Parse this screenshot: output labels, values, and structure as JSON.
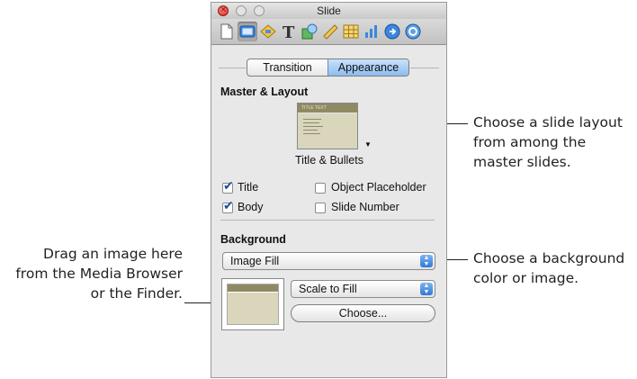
{
  "window": {
    "title": "Slide"
  },
  "toolbar": {
    "icons": [
      "document-icon",
      "slide-icon",
      "build-icon",
      "text-icon",
      "graphic-icon",
      "metrics-icon",
      "table-icon",
      "chart-icon",
      "hyperlink-icon",
      "quicktime-icon"
    ]
  },
  "tabs": {
    "transition": "Transition",
    "appearance": "Appearance",
    "active": "Appearance"
  },
  "master_layout": {
    "heading": "Master & Layout",
    "layout_name": "Title & Bullets",
    "thumb_title": "TITLE TEXT"
  },
  "checkboxes": {
    "title": {
      "label": "Title",
      "checked": true
    },
    "body": {
      "label": "Body",
      "checked": true
    },
    "object_placeholder": {
      "label": "Object Placeholder",
      "checked": false
    },
    "slide_number": {
      "label": "Slide Number",
      "checked": false
    }
  },
  "background": {
    "heading": "Background",
    "fill_value": "Image Fill",
    "scale_value": "Scale to Fill",
    "choose_label": "Choose..."
  },
  "callouts": {
    "layout": [
      "Choose a slide layout",
      "from among the",
      "master slides."
    ],
    "background": [
      "Choose a background",
      "color or image."
    ],
    "drag": [
      "Drag an image here",
      "from the Media Browser",
      "or the Finder."
    ]
  },
  "colors": {
    "accent": "#3b86e0",
    "close_button": "#d3271d",
    "thumbnail_bar": "#8f8a63"
  }
}
